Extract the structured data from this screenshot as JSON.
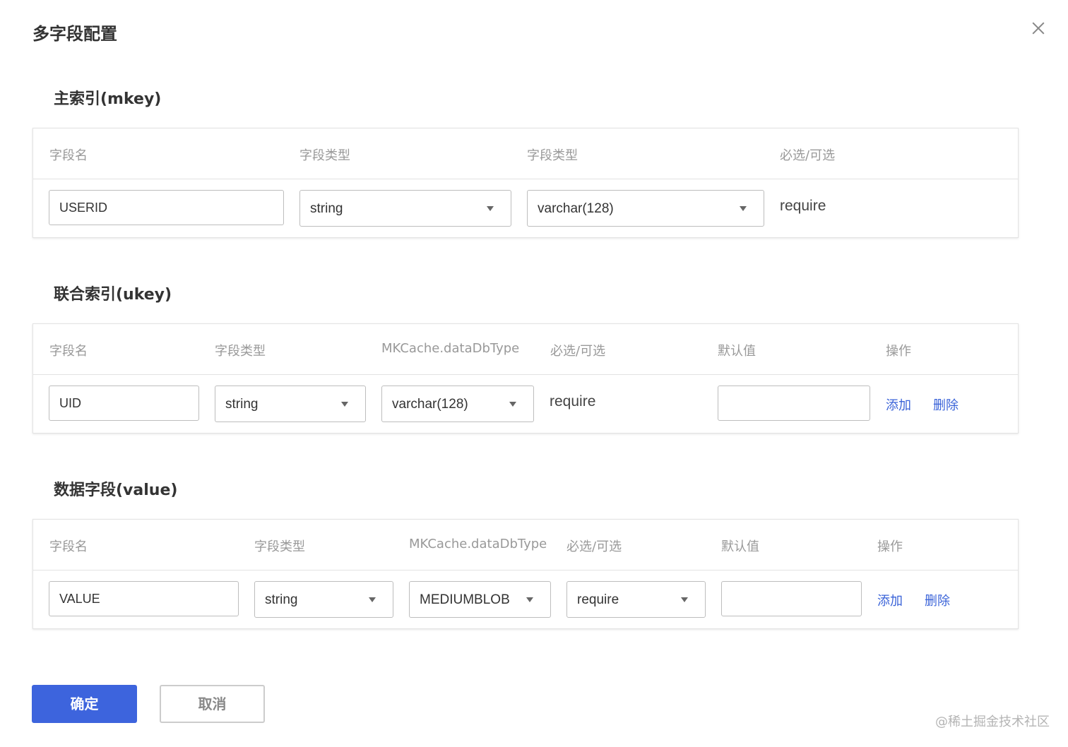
{
  "dialog": {
    "title": "多字段配置"
  },
  "sections": {
    "mkey": {
      "title": "主索引(mkey)",
      "headers": [
        "字段名",
        "字段类型",
        "字段类型",
        "必选/可选"
      ],
      "row": {
        "name": "USERID",
        "type": "string",
        "db_type": "varchar(128)",
        "required": "require"
      }
    },
    "ukey": {
      "title": "联合索引(ukey)",
      "headers": [
        "字段名",
        "字段类型",
        "MKCache.dataDbType",
        "必选/可选",
        "默认值",
        "操作"
      ],
      "row": {
        "name": "UID",
        "type": "string",
        "db_type": "varchar(128)",
        "required": "require",
        "default": "",
        "add": "添加",
        "delete": "删除"
      }
    },
    "value": {
      "title": "数据字段(value)",
      "headers": [
        "字段名",
        "字段类型",
        "MKCache.dataDbType",
        "必选/可选",
        "默认值",
        "操作"
      ],
      "row": {
        "name": "VALUE",
        "type": "string",
        "db_type": "MEDIUMBLOB",
        "required": "require",
        "default": "",
        "add": "添加",
        "delete": "删除"
      }
    }
  },
  "footer": {
    "confirm": "确定",
    "cancel": "取消"
  },
  "watermark": "@稀土掘金技术社区",
  "colors": {
    "primary": "#3d64dd",
    "link": "#3a63d8",
    "header_text": "#999999"
  }
}
